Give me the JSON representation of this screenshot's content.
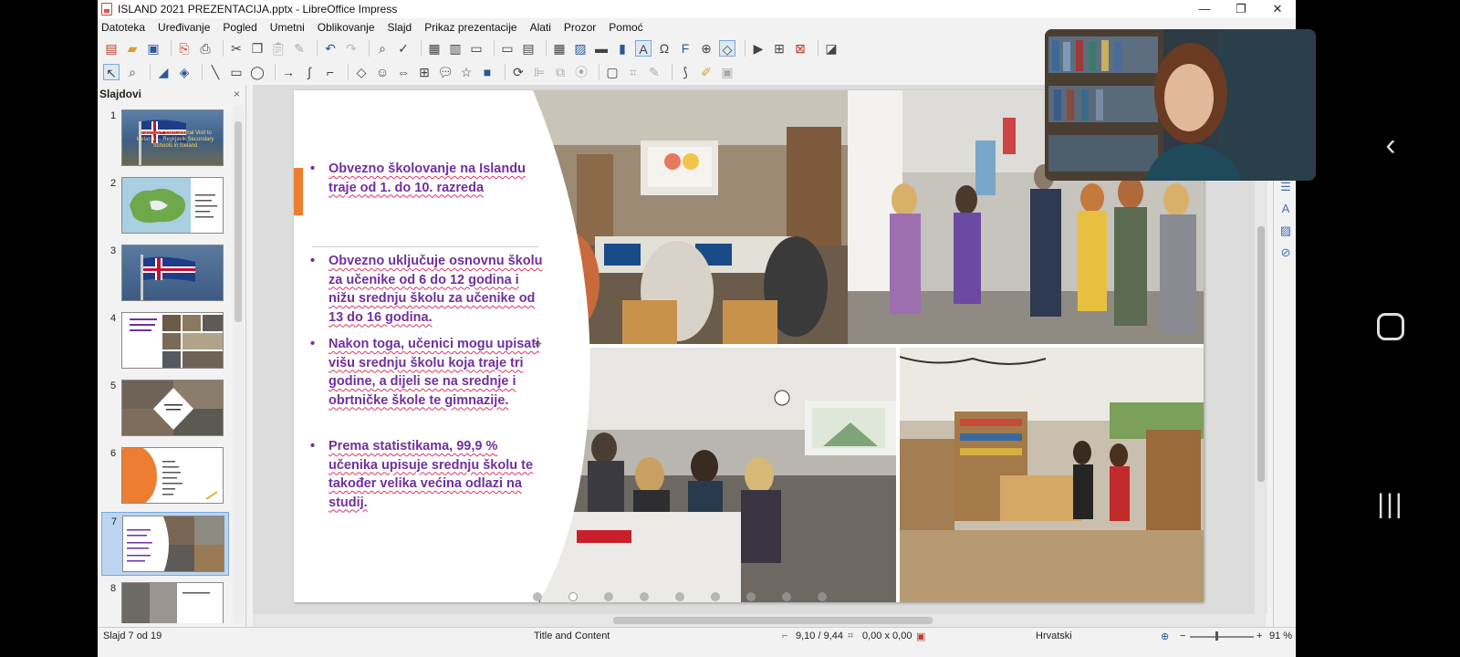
{
  "window": {
    "title": "ISLAND 2021 PREZENTACIJA.pptx - LibreOffice Impress",
    "controls": {
      "minimize": "—",
      "maximize": "❐",
      "close": "✕"
    }
  },
  "menu": [
    "Datoteka",
    "Uređivanje",
    "Pogled",
    "Umetni",
    "Oblikovanje",
    "Slajd",
    "Prikaz prezentacije",
    "Alati",
    "Prozor",
    "Pomoć"
  ],
  "slide_panel": {
    "title": "Slajdovi",
    "close": "×",
    "slides": [
      {
        "number": "1",
        "caption": "Erasmus+ Educational Visit to Iceland — Reykjavik Secondary Schools in Iceland"
      },
      {
        "number": "2"
      },
      {
        "number": "3"
      },
      {
        "number": "4"
      },
      {
        "number": "5"
      },
      {
        "number": "6"
      },
      {
        "number": "7",
        "selected": true
      },
      {
        "number": "8"
      }
    ]
  },
  "slide": {
    "bullets": [
      "Obvezno školovanje na Islandu traje od 1. do 10. razreda",
      "Obvezno uključuje osnovnu školu za učenike od 6 do 12 godina i nižu srednju školu za učenike od 13 do 16 godina.",
      "Nakon toga, učenici mogu upisati višu srednju školu koja traje tri godine, a dijeli se na srednje i obrtničke škole te gimnazije.",
      "Prema statistikama, 99,9 % učenika upisuje srednju školu te također velika većina odlazi na studij."
    ],
    "accent_color": "#ed7d31",
    "text_color": "#7030a0"
  },
  "status": {
    "slide": "Slajd 7 od 19",
    "layout": "Title and Content",
    "position": "9,10 / 9,44",
    "size": "0,00 x 0,00",
    "language": "Hrvatski",
    "zoom_minus": "−",
    "zoom_plus": "+",
    "zoom": "91 %"
  }
}
